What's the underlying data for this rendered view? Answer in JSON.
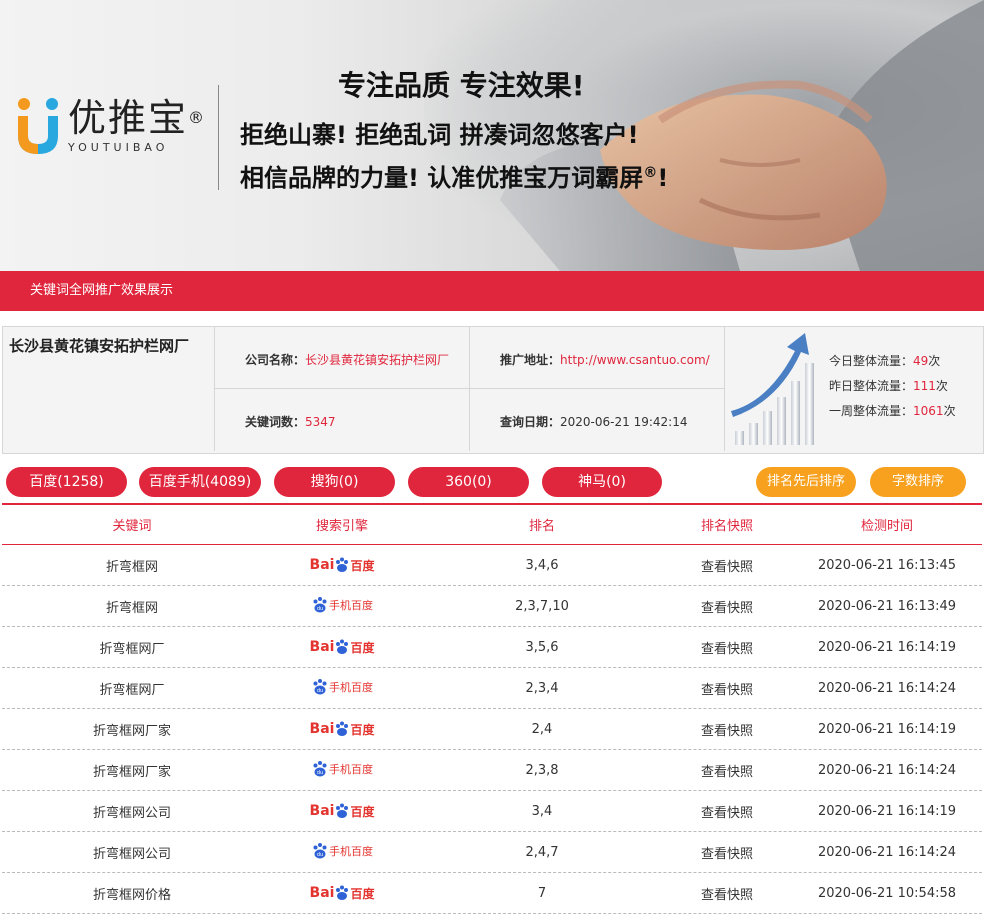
{
  "banner": {
    "logo_cn": "优推宝",
    "logo_registered": "®",
    "logo_en": "YOUTUIBAO",
    "slogan_1": "专注品质 专注效果!",
    "slogan_2": "拒绝山寨! 拒绝乱词 拼凑词忽悠客户!",
    "slogan_3": "相信品牌的力量! 认准优推宝万词霸屏",
    "slogan_3_registered": "®",
    "slogan_3_end": "!"
  },
  "section_title": "关键词全网推广效果展示",
  "info": {
    "company": "长沙县黄花镇安拓护栏网厂",
    "name_label": "公司名称：",
    "name_value": "长沙县黄花镇安拓护栏网厂",
    "url_label": "推广地址：",
    "url_value": "http://www.csantuo.com/",
    "kw_label": "关键词数：",
    "kw_value": "5347",
    "date_label": "查询日期：",
    "date_value": "2020-06-21 19:42:14",
    "traffic_today_label": "今日整体流量：",
    "traffic_today_value": "49",
    "traffic_yesterday_label": "昨日整体流量：",
    "traffic_yesterday_value": "111",
    "traffic_week_label": "一周整体流量：",
    "traffic_week_value": "1061",
    "unit": "次"
  },
  "tabs": [
    {
      "label": "百度(1258)"
    },
    {
      "label": "百度手机(4089)"
    },
    {
      "label": "搜狗(0)"
    },
    {
      "label": "360(0)"
    },
    {
      "label": "神马(0)"
    }
  ],
  "sort_buttons": [
    {
      "label": "排名先后排序"
    },
    {
      "label": "字数排序"
    }
  ],
  "table": {
    "headers": [
      "关键词",
      "搜索引擎",
      "排名",
      "排名快照",
      "检测时间"
    ],
    "engine_labels": {
      "baidu_text": "Bai",
      "baidu_du": "du",
      "baidu_cn": "百度",
      "mobile_cn": "手机百度"
    },
    "rows": [
      {
        "keyword": "折弯框网",
        "engine": "baidu",
        "rank": "3,4,6",
        "snapshot": "查看快照",
        "time": "2020-06-21 16:13:45"
      },
      {
        "keyword": "折弯框网",
        "engine": "mobile",
        "rank": "2,3,7,10",
        "snapshot": "查看快照",
        "time": "2020-06-21 16:13:49"
      },
      {
        "keyword": "折弯框网厂",
        "engine": "baidu",
        "rank": "3,5,6",
        "snapshot": "查看快照",
        "time": "2020-06-21 16:14:19"
      },
      {
        "keyword": "折弯框网厂",
        "engine": "mobile",
        "rank": "2,3,4",
        "snapshot": "查看快照",
        "time": "2020-06-21 16:14:24"
      },
      {
        "keyword": "折弯框网厂家",
        "engine": "baidu",
        "rank": "2,4",
        "snapshot": "查看快照",
        "time": "2020-06-21 16:14:19"
      },
      {
        "keyword": "折弯框网厂家",
        "engine": "mobile",
        "rank": "2,3,8",
        "snapshot": "查看快照",
        "time": "2020-06-21 16:14:24"
      },
      {
        "keyword": "折弯框网公司",
        "engine": "baidu",
        "rank": "3,4",
        "snapshot": "查看快照",
        "time": "2020-06-21 16:14:19"
      },
      {
        "keyword": "折弯框网公司",
        "engine": "mobile",
        "rank": "2,4,7",
        "snapshot": "查看快照",
        "time": "2020-06-21 16:14:24"
      },
      {
        "keyword": "折弯框网价格",
        "engine": "baidu",
        "rank": "7",
        "snapshot": "查看快照",
        "time": "2020-06-21 10:54:58"
      }
    ]
  },
  "colors": {
    "brand_red": "#e0263d",
    "accent_orange": "#f7a11e",
    "baidu_blue": "#2f62d6"
  }
}
